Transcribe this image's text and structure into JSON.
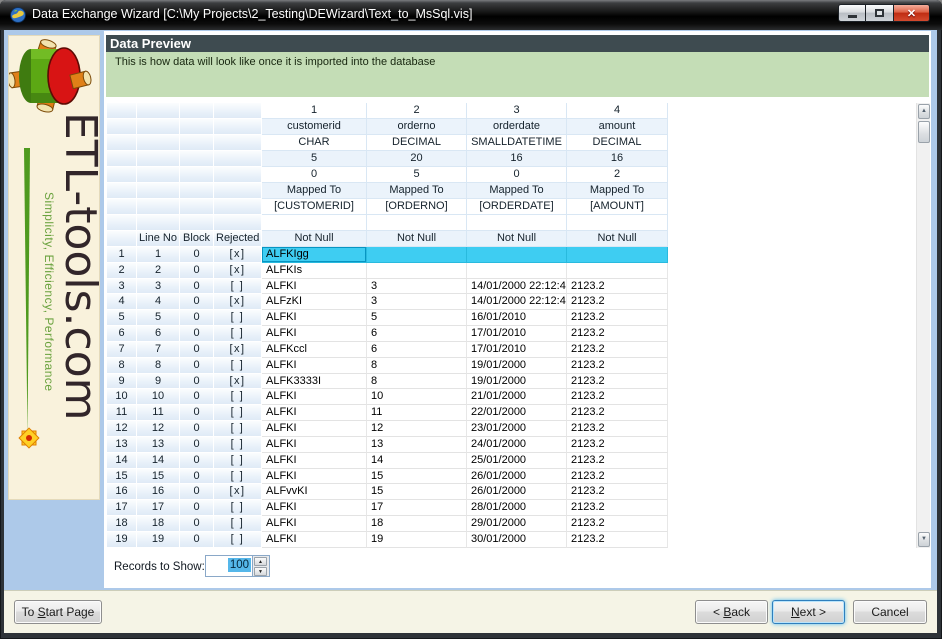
{
  "window": {
    "title": "Data Exchange Wizard [C:\\My Projects\\2_Testing\\DEWizard\\Text_to_MsSql.vis]"
  },
  "sidebar": {
    "brand": "ETL-tools.com",
    "tagline": "Simplicity, Efficiency, Performance"
  },
  "header": {
    "title": "Data Preview",
    "subtitle": "This is how data will look like once it is imported into the database"
  },
  "grid": {
    "gutter_headers": {
      "line_no": "Line No",
      "block": "Block",
      "rejected": "Rejected"
    },
    "column_numbers": [
      "1",
      "2",
      "3",
      "4"
    ],
    "column_names": [
      "customerid",
      "orderno",
      "orderdate",
      "amount"
    ],
    "column_types": [
      "CHAR",
      "DECIMAL",
      "SMALLDATETIME",
      "DECIMAL"
    ],
    "column_sizes": [
      "5",
      "20",
      "16",
      "16"
    ],
    "column_scales": [
      "0",
      "5",
      "0",
      "2"
    ],
    "mapped_to_label": [
      "Mapped To",
      "Mapped To",
      "Mapped To",
      "Mapped To"
    ],
    "mapped_to_field": [
      "[CUSTOMERID]",
      "[ORDERNO]",
      "[ORDERDATE]",
      "[AMOUNT]"
    ],
    "not_null": [
      "Not Null",
      "Not Null",
      "Not Null",
      "Not Null"
    ],
    "rows": [
      {
        "n": "1",
        "line": "1",
        "block": "0",
        "rejected": "[x]",
        "customerid": "ALFKIgg",
        "orderno": "",
        "orderdate": "",
        "amount": "",
        "selected": true
      },
      {
        "n": "2",
        "line": "2",
        "block": "0",
        "rejected": "[x]",
        "customerid": "ALFKIs",
        "orderno": "",
        "orderdate": "",
        "amount": ""
      },
      {
        "n": "3",
        "line": "3",
        "block": "0",
        "rejected": "[ ]",
        "customerid": "ALFKI",
        "orderno": "3",
        "orderdate": "14/01/2000 22:12:4",
        "amount": "2123.2"
      },
      {
        "n": "4",
        "line": "4",
        "block": "0",
        "rejected": "[x]",
        "customerid": "ALFzKI",
        "orderno": "3",
        "orderdate": "14/01/2000 22:12:4",
        "amount": "2123.2"
      },
      {
        "n": "5",
        "line": "5",
        "block": "0",
        "rejected": "[ ]",
        "customerid": "ALFKI",
        "orderno": "5",
        "orderdate": "16/01/2010",
        "amount": "2123.2"
      },
      {
        "n": "6",
        "line": "6",
        "block": "0",
        "rejected": "[ ]",
        "customerid": "ALFKI",
        "orderno": "6",
        "orderdate": "17/01/2010",
        "amount": "2123.2"
      },
      {
        "n": "7",
        "line": "7",
        "block": "0",
        "rejected": "[x]",
        "customerid": "ALFKccl",
        "orderno": "6",
        "orderdate": "17/01/2010",
        "amount": "2123.2"
      },
      {
        "n": "8",
        "line": "8",
        "block": "0",
        "rejected": "[ ]",
        "customerid": "ALFKI",
        "orderno": "8",
        "orderdate": "19/01/2000",
        "amount": "2123.2"
      },
      {
        "n": "9",
        "line": "9",
        "block": "0",
        "rejected": "[x]",
        "customerid": "ALFK3333I",
        "orderno": "8",
        "orderdate": "19/01/2000",
        "amount": "2123.2"
      },
      {
        "n": "10",
        "line": "10",
        "block": "0",
        "rejected": "[ ]",
        "customerid": "ALFKI",
        "orderno": "10",
        "orderdate": "21/01/2000",
        "amount": "2123.2"
      },
      {
        "n": "11",
        "line": "11",
        "block": "0",
        "rejected": "[ ]",
        "customerid": "ALFKI",
        "orderno": "11",
        "orderdate": "22/01/2000",
        "amount": "2123.2"
      },
      {
        "n": "12",
        "line": "12",
        "block": "0",
        "rejected": "[ ]",
        "customerid": "ALFKI",
        "orderno": "12",
        "orderdate": "23/01/2000",
        "amount": "2123.2"
      },
      {
        "n": "13",
        "line": "13",
        "block": "0",
        "rejected": "[ ]",
        "customerid": "ALFKI",
        "orderno": "13",
        "orderdate": "24/01/2000",
        "amount": "2123.2"
      },
      {
        "n": "14",
        "line": "14",
        "block": "0",
        "rejected": "[ ]",
        "customerid": "ALFKI",
        "orderno": "14",
        "orderdate": "25/01/2000",
        "amount": "2123.2"
      },
      {
        "n": "15",
        "line": "15",
        "block": "0",
        "rejected": "[ ]",
        "customerid": "ALFKI",
        "orderno": "15",
        "orderdate": "26/01/2000",
        "amount": "2123.2"
      },
      {
        "n": "16",
        "line": "16",
        "block": "0",
        "rejected": "[x]",
        "customerid": "ALFvvKI",
        "orderno": "15",
        "orderdate": "26/01/2000",
        "amount": "2123.2"
      },
      {
        "n": "17",
        "line": "17",
        "block": "0",
        "rejected": "[ ]",
        "customerid": "ALFKI",
        "orderno": "17",
        "orderdate": "28/01/2000",
        "amount": "2123.2"
      },
      {
        "n": "18",
        "line": "18",
        "block": "0",
        "rejected": "[ ]",
        "customerid": "ALFKI",
        "orderno": "18",
        "orderdate": "29/01/2000",
        "amount": "2123.2"
      },
      {
        "n": "19",
        "line": "19",
        "block": "0",
        "rejected": "[ ]",
        "customerid": "ALFKI",
        "orderno": "19",
        "orderdate": "30/01/2000",
        "amount": "2123.2"
      }
    ]
  },
  "records": {
    "label": "Records to Show:",
    "value": "100"
  },
  "footer": {
    "to_start_page": {
      "prefix": "To ",
      "mnemonic": "S",
      "suffix": "tart Page"
    },
    "back": {
      "prefix": "< ",
      "mnemonic": "B",
      "suffix": "ack"
    },
    "next": {
      "prefix": "",
      "mnemonic": "N",
      "suffix": "ext >"
    },
    "cancel": {
      "label": "Cancel"
    }
  },
  "colors": {
    "selection": "#3ecdf2",
    "header_bar": "#3e4b50",
    "info_panel": "#c4ddb6",
    "sidebar_bg": "#f9f2dc",
    "client_bg": "#adc9e9",
    "close_button": "#c8381e"
  }
}
